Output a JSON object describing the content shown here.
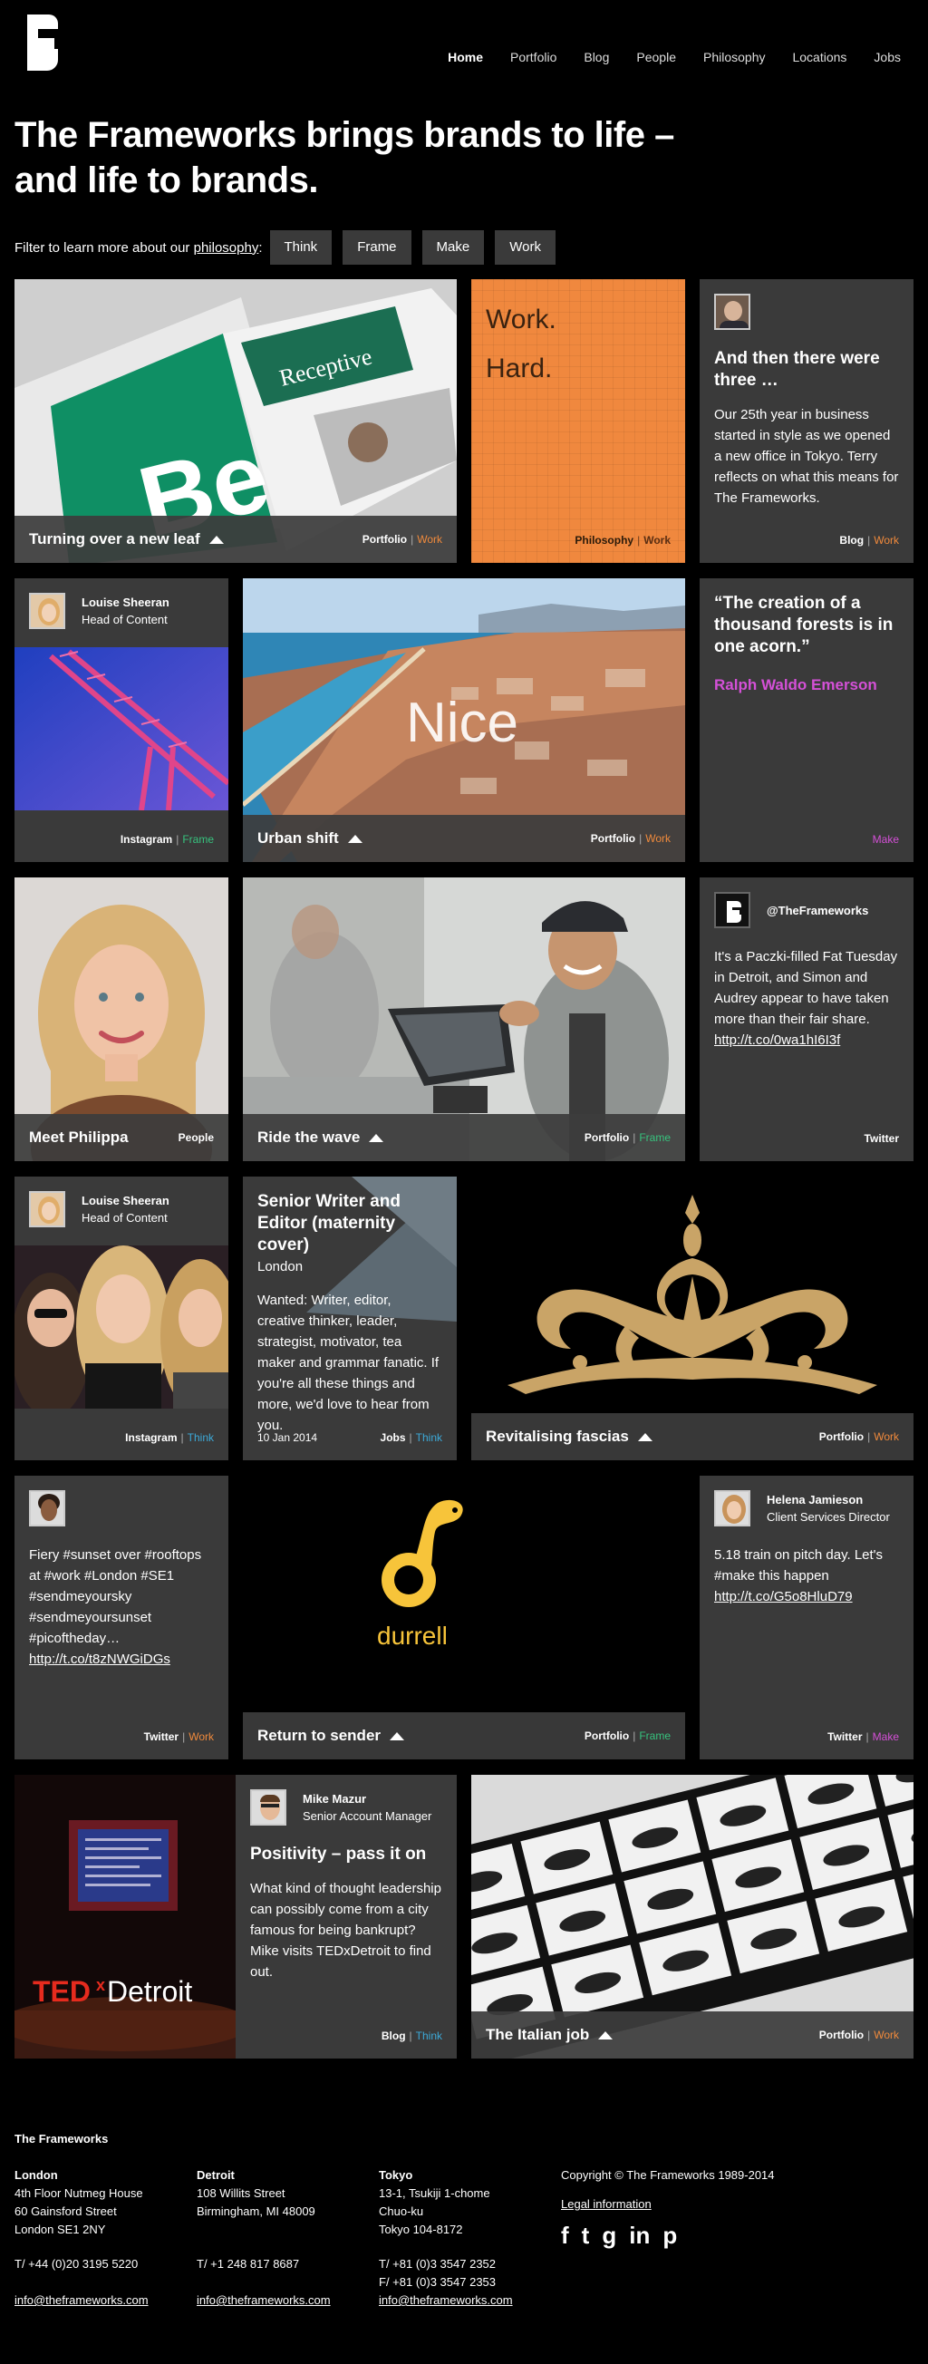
{
  "nav": {
    "items": [
      "Home",
      "Portfolio",
      "Blog",
      "People",
      "Philosophy",
      "Locations",
      "Jobs"
    ]
  },
  "headline": {
    "line1": "The Frameworks brings brands to life –",
    "line2": "and life to brands."
  },
  "filter": {
    "label_prefix": "Filter to learn more about our",
    "label_link": "philosophy",
    "label_suffix": ":",
    "buttons": [
      "Think",
      "Frame",
      "Make",
      "Work"
    ]
  },
  "tiles": {
    "leaf": {
      "title": "Turning over a new leaf",
      "cat": "Portfolio",
      "tag": "Work",
      "img_text1": "Receptive",
      "img_text2": "Be"
    },
    "workhard": {
      "line1": "Work.",
      "line2": "Hard.",
      "cat": "Philosophy",
      "tag": "Work"
    },
    "three": {
      "title": "And then there were three …",
      "body": "Our 25th year in business started in style as we opened a new office in Tokyo. Terry reflects on what this means for The Frameworks.",
      "cat": "Blog",
      "tag": "Work"
    },
    "louise1": {
      "name": "Louise Sheeran",
      "role": "Head of Content",
      "cat": "Instagram",
      "tag": "Frame"
    },
    "urban": {
      "title": "Urban shift",
      "img_text": "Nice",
      "cat": "Portfolio",
      "tag": "Work"
    },
    "quote": {
      "text": "“The creation of a thousand forests is in one acorn.”",
      "author": "Ralph Waldo Emerson",
      "tag": "Make"
    },
    "philippa": {
      "title": "Meet Philippa",
      "cat": "People"
    },
    "wave": {
      "title": "Ride the wave",
      "cat": "Portfolio",
      "tag": "Frame"
    },
    "tweet1": {
      "handle": "@TheFrameworks",
      "body": "It's a Paczki-filled Fat Tuesday in Detroit, and Simon and Audrey appear to have taken more than their fair share.",
      "link": "http://t.co/0wa1hI6I3f",
      "cat": "Twitter"
    },
    "louise2": {
      "name": "Louise Sheeran",
      "role": "Head of Content",
      "cat": "Instagram",
      "tag": "Think"
    },
    "job": {
      "title": "Senior Writer and Editor (maternity cover)",
      "location": "London",
      "body": "Wanted: Writer, editor, creative thinker, leader, strategist, motivator, tea maker and grammar fanatic. If you're all these things and more, we'd love to hear from you.",
      "date": "10 Jan 2014",
      "cat": "Jobs",
      "tag": "Think"
    },
    "fascias": {
      "title": "Revitalising fascias",
      "cat": "Portfolio",
      "tag": "Work"
    },
    "sunset": {
      "body": "Fiery #sunset over #rooftops at #work #London #SE1 #sendmeyoursky #sendmeyoursunset #picoftheday…",
      "link": "http://t.co/t8zNWGiDGs",
      "cat": "Twitter",
      "tag": "Work"
    },
    "durrell": {
      "logo_text": "durrell",
      "title": "Return to sender",
      "cat": "Portfolio",
      "tag": "Frame"
    },
    "helena": {
      "name": "Helena Jamieson",
      "role": "Client Services Director",
      "body": "5.18 train on pitch day. Let's #make this happen",
      "link": "http://t.co/G5o8HluD79",
      "cat": "Twitter",
      "tag": "Make"
    },
    "tedx": {
      "brand1": "TED",
      "brand2": "x",
      "brand3": "Detroit"
    },
    "mike": {
      "name": "Mike Mazur",
      "role": "Senior Account Manager",
      "title": "Positivity – pass it on",
      "body": "What kind of thought leadership can possibly come from a city famous for being bankrupt? Mike visits TEDxDetroit to find out.",
      "cat": "Blog",
      "tag": "Think"
    },
    "italian": {
      "title": "The Italian job",
      "cat": "Portfolio",
      "tag": "Work"
    }
  },
  "footer": {
    "company": "The Frameworks",
    "london": {
      "city": "London",
      "l1": "4th Floor Nutmeg House",
      "l2": "60 Gainsford Street",
      "l3": "London SE1 2NY",
      "tel": "T/ +44 (0)20 3195 5220",
      "email": "info@theframeworks.com"
    },
    "detroit": {
      "city": "Detroit",
      "l1": "108 Willits Street",
      "l2": "Birmingham, MI 48009",
      "tel": "T/ +1 248 817 8687",
      "email": "info@theframeworks.com"
    },
    "tokyo": {
      "city": "Tokyo",
      "l1": "13-1, Tsukiji 1-chome",
      "l2": "Chuo-ku",
      "l3": "Tokyo 104-8172",
      "tel": "T/ +81 (0)3 3547 2352",
      "fax": "F/ +81 (0)3 3547 2353",
      "email": "info@theframeworks.com"
    },
    "copyright": "Copyright © The Frameworks 1989-2014",
    "legal": "Legal information",
    "social": [
      "f",
      "t",
      "g",
      "in",
      "p"
    ]
  },
  "colors": {
    "work": "#f08a3c",
    "frame": "#37c37e",
    "make": "#d450d7",
    "think": "#3ca9d8",
    "orange_tile": "#f0883e",
    "gold": "#c9a467",
    "durrell_yellow": "#f7c43a"
  }
}
